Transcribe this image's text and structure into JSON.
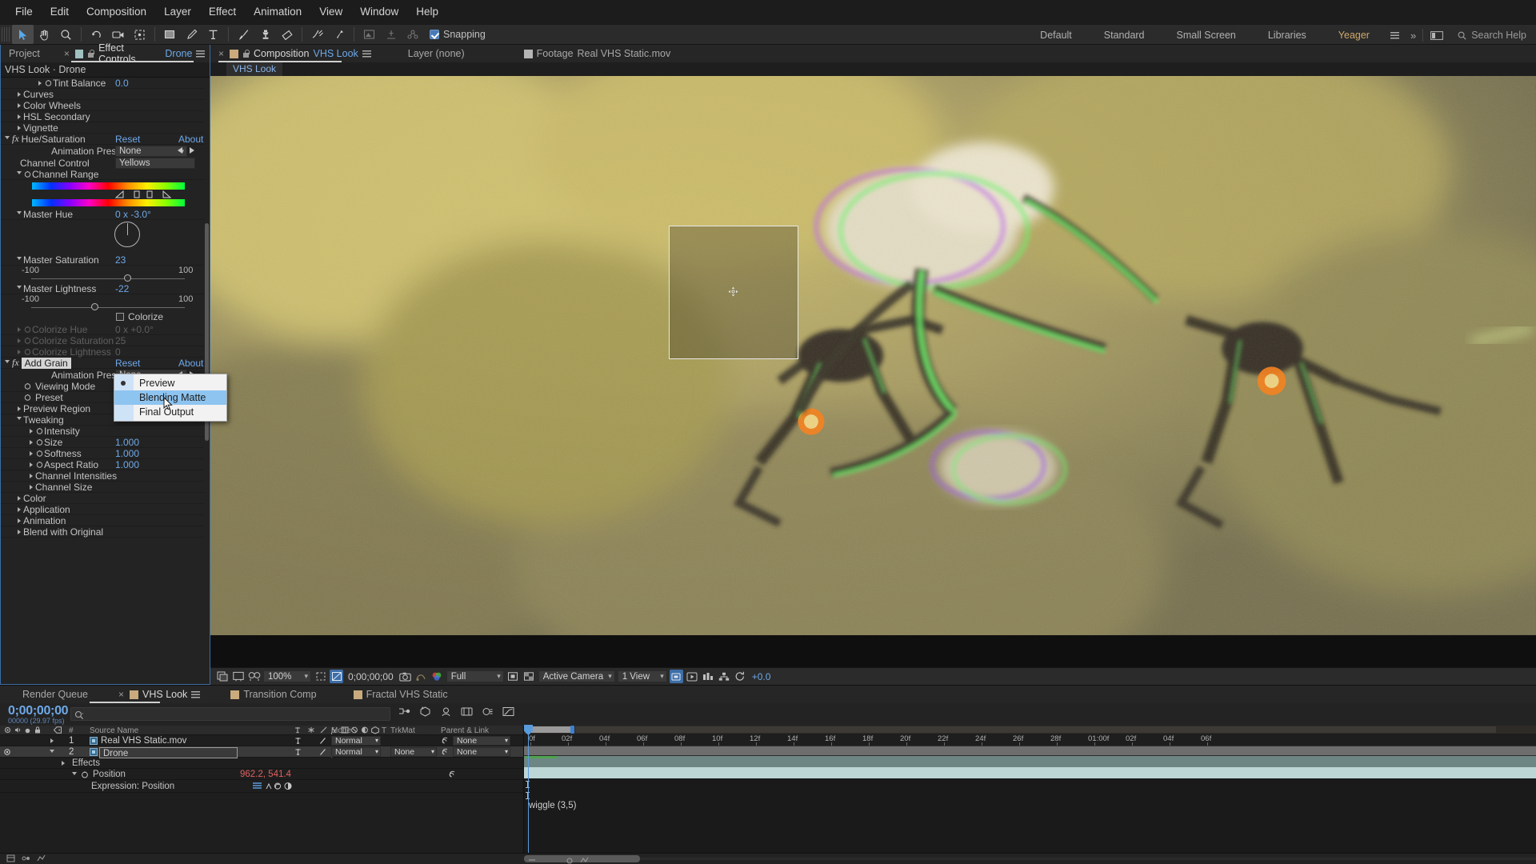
{
  "menubar": {
    "items": [
      "File",
      "Edit",
      "Composition",
      "Layer",
      "Effect",
      "Animation",
      "View",
      "Window",
      "Help"
    ]
  },
  "toolbar": {
    "snapping_label": "Snapping",
    "workspaces": [
      "Default",
      "Standard",
      "Small Screen",
      "Libraries"
    ],
    "user": "Yeager",
    "overflow": "»",
    "search_help": "Search Help"
  },
  "panels": {
    "project_tab": "Project",
    "effect_controls_tab": "Effect Controls",
    "effect_controls_target": "Drone",
    "composition_tab": "Composition",
    "composition_target": "VHS Look",
    "layer_tab": "Layer (none)",
    "footage_tab": "Footage",
    "footage_target": "Real VHS Static.mov"
  },
  "effect_controls": {
    "path": "VHS Look · Drone",
    "rows": [
      {
        "label": "Tint Balance",
        "value": "0.0",
        "indent": 36,
        "twirl": "closed",
        "stopwatch": true
      },
      {
        "label": "Curves",
        "indent": 14,
        "twirl": "closed"
      },
      {
        "label": "Color Wheels",
        "indent": 14,
        "twirl": "closed"
      },
      {
        "label": "HSL Secondary",
        "indent": 14,
        "twirl": "closed"
      },
      {
        "label": "Vignette",
        "indent": 14,
        "twirl": "closed"
      }
    ],
    "hue_saturation": {
      "name": "Hue/Saturation",
      "reset": "Reset",
      "about": "About",
      "animation_presets_label": "Animation Presets:",
      "animation_presets_value": "None",
      "channel_control_label": "Channel Control",
      "channel_control_value": "Yellows",
      "channel_range_label": "Channel Range",
      "master_hue_label": "Master Hue",
      "master_hue_value": "0 x -3.0°",
      "master_saturation_label": "Master Saturation",
      "master_saturation_value": "23",
      "master_saturation_min": "-100",
      "master_saturation_max": "100",
      "master_lightness_label": "Master Lightness",
      "master_lightness_value": "-22",
      "master_lightness_min": "-100",
      "master_lightness_max": "100",
      "colorize_label": "Colorize",
      "colorize_hue_label": "Colorize Hue",
      "colorize_hue_value": "0 x +0.0°",
      "colorize_saturation_label": "Colorize Saturation",
      "colorize_saturation_value": "25",
      "colorize_lightness_label": "Colorize Lightness",
      "colorize_lightness_value": "0"
    },
    "add_grain": {
      "name": "Add Grain",
      "reset": "Reset",
      "about": "About",
      "animation_presets_label": "Animation Presets:",
      "animation_presets_value": "None",
      "viewing_mode_label": "Viewing Mode",
      "viewing_mode_value": "Preview",
      "preset_label": "Preset",
      "preview_region_label": "Preview Region",
      "tweaking_label": "Tweaking",
      "intensity_label": "Intensity",
      "size_label": "Size",
      "size_value": "1.000",
      "softness_label": "Softness",
      "softness_value": "1.000",
      "aspect_ratio_label": "Aspect Ratio",
      "aspect_ratio_value": "1.000",
      "channel_intensities_label": "Channel Intensities",
      "channel_size_label": "Channel Size",
      "color_label": "Color",
      "application_label": "Application",
      "animation_label": "Animation",
      "blend_with_original_label": "Blend with Original"
    }
  },
  "viewing_mode_menu": {
    "items": [
      {
        "label": "Preview",
        "selected": true,
        "highlighted": false
      },
      {
        "label": "Blending Matte",
        "selected": false,
        "highlighted": true
      },
      {
        "label": "Final Output",
        "selected": false,
        "highlighted": false
      }
    ]
  },
  "viewer_toolbar": {
    "magnification": "100%",
    "timecode": "0;00;00;00",
    "resolution": "Full",
    "camera": "Active Camera",
    "views": "1 View",
    "exposure": "+0.0"
  },
  "timeline": {
    "tabs": [
      {
        "label": "Render Queue",
        "active": false
      },
      {
        "label": "VHS Look",
        "active": true
      },
      {
        "label": "Transition Comp",
        "active": false
      },
      {
        "label": "Fractal VHS Static",
        "active": false
      }
    ],
    "current_time": "0;00;00;00",
    "frame_info": "00000 (29.97 fps)",
    "search_placeholder": "",
    "columns": [
      "#",
      "Source Name",
      "Mode",
      "T",
      "TrkMat",
      "Parent & Link"
    ],
    "layers": [
      {
        "index": "1",
        "name": "Real VHS Static.mov",
        "mode": "Normal",
        "trkmat": "",
        "parent": "None",
        "selected": false,
        "has_fx": false,
        "eye": false
      },
      {
        "index": "2",
        "name": "Drone",
        "mode": "Normal",
        "trkmat": "None",
        "parent": "None",
        "selected": true,
        "has_fx": true,
        "eye": true
      }
    ],
    "drone_effects_label": "Effects",
    "drone_position_label": "Position",
    "drone_position_value": "962.2, 541.4",
    "drone_expression_label": "Expression: Position",
    "drone_expression_text": "wiggle (3,5)",
    "ruler_ticks": [
      "0f",
      "02f",
      "04f",
      "06f",
      "08f",
      "10f",
      "12f",
      "14f",
      "16f",
      "18f",
      "20f",
      "22f",
      "24f",
      "26f",
      "28f",
      "01:00f",
      "02f",
      "04f",
      "06f"
    ]
  }
}
